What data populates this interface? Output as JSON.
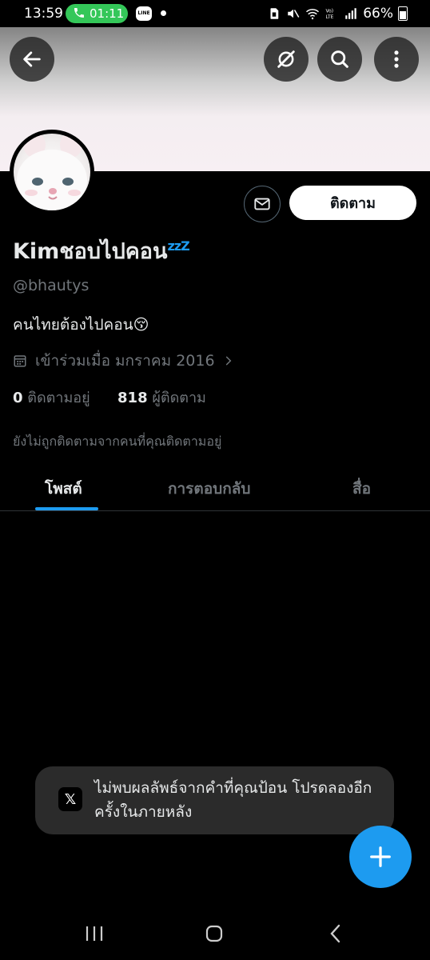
{
  "status_bar": {
    "time": "13:59",
    "call_duration": "01:11",
    "line_label": "LINE",
    "battery": "66%",
    "icons": [
      "phone-icon",
      "line-app-icon",
      "notification-dot",
      "sim-icon",
      "mute-icon",
      "wifi-icon",
      "volte-lte-icon",
      "signal-icon",
      "battery-icon"
    ]
  },
  "header": {
    "back_icon": "arrow-left-icon",
    "actions": [
      "grok-icon",
      "search-icon",
      "more-vertical-icon"
    ]
  },
  "profile": {
    "display_name": "Kimชอบไปคอน",
    "name_emoji": "zzZ",
    "handle": "@bhautys",
    "bio": "คนไทยต้องไปคอน😚",
    "joined": "เข้าร่วมเมื่อ มกราคม 2016",
    "following_count": "0",
    "following_label": "ติดตามอยู่",
    "followers_count": "818",
    "followers_label": "ผู้ติดตาม",
    "not_followed_note": "ยังไม่ถูกติดตามจากคนที่คุณติดตามอยู่",
    "follow_button": "ติดตาม",
    "message_icon": "envelope-icon"
  },
  "tabs": [
    {
      "label": "โพสต์",
      "active": true
    },
    {
      "label": "การตอบกลับ",
      "active": false
    },
    {
      "label": "สื่อ",
      "active": false
    }
  ],
  "toast": {
    "logo": "𝕏",
    "message": "ไม่พบผลลัพธ์จากคำที่คุณป้อน โปรดลองอีกครั้งในภายหลัง"
  },
  "fab": {
    "icon": "plus-icon"
  },
  "nav": [
    "recents-icon",
    "home-icon",
    "back-icon"
  ],
  "colors": {
    "accent": "#1d9bf0",
    "background": "#000000",
    "call_green": "#34c759"
  }
}
